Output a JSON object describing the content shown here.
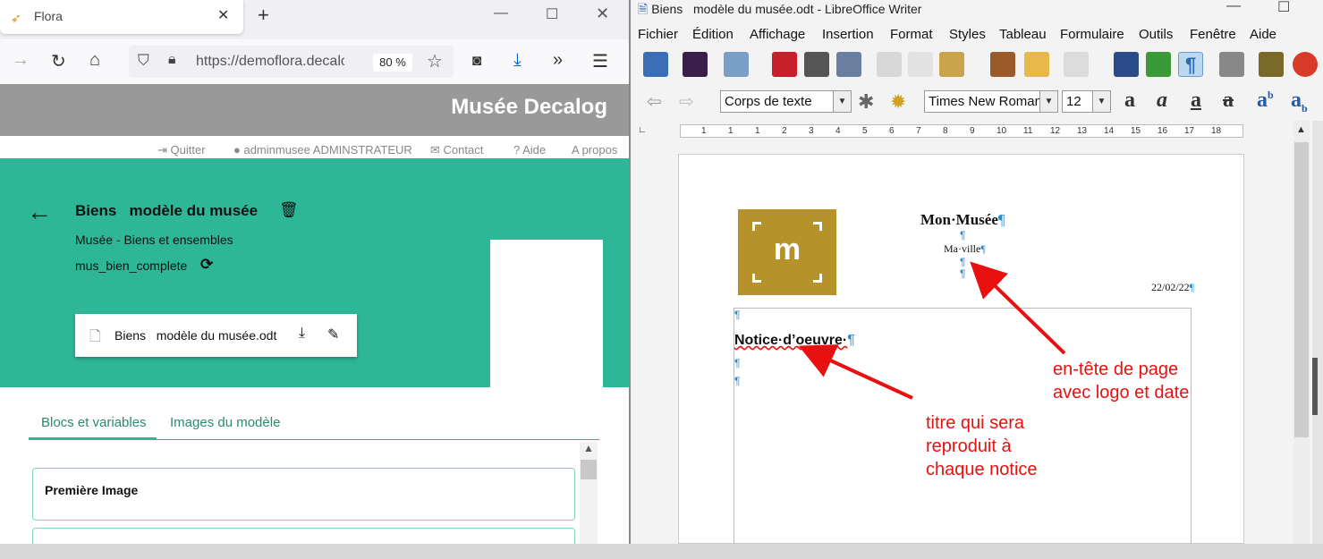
{
  "browser": {
    "tab_title": "Flora",
    "url": "https://demoflora.decalog",
    "zoom": "80 %"
  },
  "site": {
    "header_title": "Musée Decalog",
    "links": {
      "quit": "Quitter",
      "user": "adminmusee ADMINSTRATEUR",
      "contact": "Contact",
      "help": "Aide",
      "about": "A propos"
    },
    "model_title": "Biens   modèle du musée",
    "model_subtitle": "Musée - Biens et ensembles",
    "model_code": "mus_bien_complete",
    "file_name": "Biens   modèle du musée.odt",
    "tabs": [
      "Blocs et variables",
      "Images du modèle"
    ],
    "block1": "Première Image"
  },
  "writer": {
    "title": "Biens   modèle du musée.odt - LibreOffice Writer",
    "menu": [
      "Fichier",
      "Édition",
      "Affichage",
      "Insertion",
      "Format",
      "Styles",
      "Tableau",
      "Formulaire",
      "Outils",
      "Fenêtre",
      "Aide"
    ],
    "para_style": "Corps de texte",
    "font_name": "Times New Roman",
    "font_size": "12",
    "ruler_ticks": [
      "1",
      "1",
      "1",
      "2",
      "3",
      "4",
      "5",
      "6",
      "7",
      "8",
      "9",
      "10",
      "11",
      "12",
      "13",
      "14",
      "15",
      "16",
      "17",
      "18"
    ],
    "doc": {
      "header_title": "Mon·Musée",
      "header_city": "Ma·ville",
      "date": "22/02/22",
      "logo_letter": "m",
      "notice_title": "Notice·d’oeuvre·"
    }
  },
  "annotations": {
    "header_note": "en-tête de page\navec logo et date",
    "title_note": "titre qui sera\nreproduit à\nchaque notice"
  },
  "colors": {
    "accent_green": "#2db797",
    "logo_gold": "#b5922a",
    "annotation_red": "#e81010"
  }
}
